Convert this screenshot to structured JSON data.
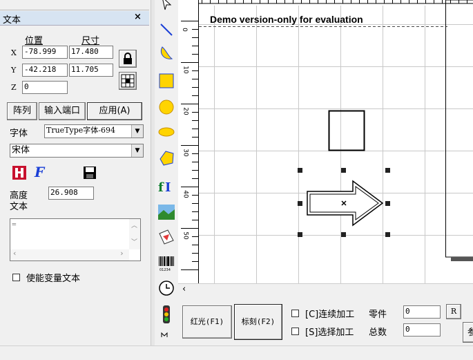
{
  "panel": {
    "title": "文本",
    "close": "×",
    "pos_header": "位置",
    "size_header": "尺寸",
    "x_label": "X",
    "y_label": "Y",
    "z_label": "Z",
    "x_pos": "-78.999",
    "x_size": "17.480",
    "y_pos": "-42.218",
    "y_size": "11.705",
    "z_pos": "0",
    "array_btn": "阵列",
    "input_port_btn": "输入端口",
    "apply_btn": "应用(A)",
    "font_label": "字体",
    "font_type": "TrueType字体-694",
    "font_name": "宋体",
    "height_label": "高度",
    "height_value": "26.908",
    "text_label": "文本",
    "text_value": "=",
    "enable_var_text": "使能变量文本"
  },
  "canvas": {
    "demo_text": "Demo version-only for evaluation",
    "ruler_labels": [
      "0",
      "10",
      "20",
      "30",
      "40",
      "50"
    ]
  },
  "bottom": {
    "red_light_btn": "红光(F1)",
    "mark_btn": "标刻(F2)",
    "continuous_label": "[C]连续加工",
    "select_label": "[S]选择加工",
    "part_label": "零件",
    "total_label": "总数",
    "part_value": "0",
    "total_value": "0",
    "r_btn": "R",
    "param_btn": "参"
  },
  "colors": {
    "accent_yellow": "#ffd400",
    "panel_bg": "#f0f0f0",
    "canvas_bg": "#ffffff"
  }
}
